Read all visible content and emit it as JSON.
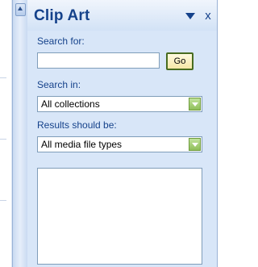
{
  "pane": {
    "title": "Clip Art",
    "close_label": "x"
  },
  "search": {
    "label": "Search for:",
    "value": "",
    "placeholder": "",
    "go_label": "Go"
  },
  "search_in": {
    "label": "Search in:",
    "selected": "All collections"
  },
  "results_type": {
    "label": "Results should be:",
    "selected": "All media file types"
  },
  "icons": {
    "menu": "chevron-down-icon",
    "close": "close-icon",
    "dropdown": "chevron-down-icon",
    "scroll_up": "arrow-up-icon"
  },
  "colors": {
    "title": "#15428b",
    "pane_background": "#d8e6f8",
    "dropdown_button": "#8fbf5a",
    "go_button_border": "#486c20"
  }
}
